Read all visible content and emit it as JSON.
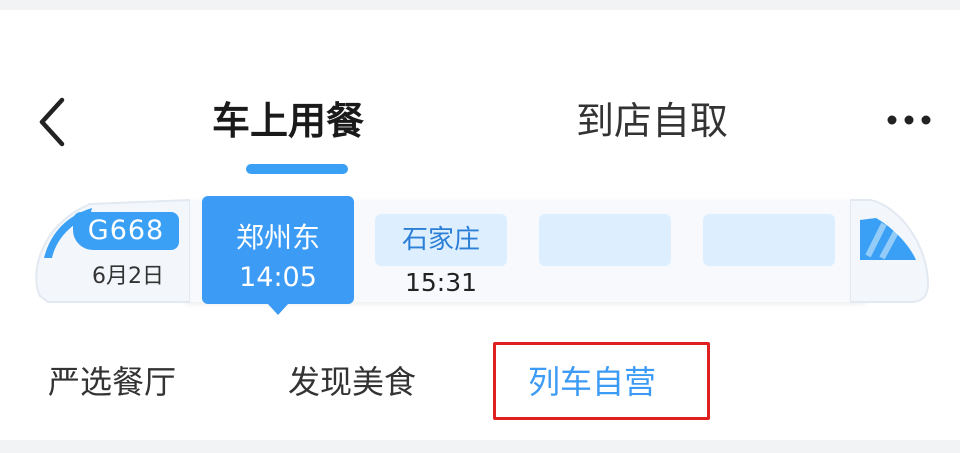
{
  "header": {
    "back_icon": "chevron-left-icon",
    "tabs": [
      {
        "label": "车上用餐",
        "active": true
      },
      {
        "label": "到店自取",
        "active": false
      }
    ],
    "more_icon": "more-horizontal-icon"
  },
  "train": {
    "number": "G668",
    "date": "6月2日",
    "accent_color": "#3aa0f5",
    "stops": [
      {
        "name": "郑州东",
        "time": "14:05",
        "selected": true
      },
      {
        "name": "石家庄",
        "time": "15:31",
        "selected": false
      },
      {
        "name": "",
        "time": "",
        "selected": false
      },
      {
        "name": "",
        "time": "",
        "selected": false
      }
    ]
  },
  "categories": [
    {
      "label": "严选餐厅",
      "active": false
    },
    {
      "label": "发现美食",
      "active": false
    },
    {
      "label": "列车自营",
      "active": true
    }
  ],
  "colors": {
    "accent": "#3c9bf5",
    "highlight_border": "#e02020",
    "stop_placeholder": "#ddefff"
  }
}
